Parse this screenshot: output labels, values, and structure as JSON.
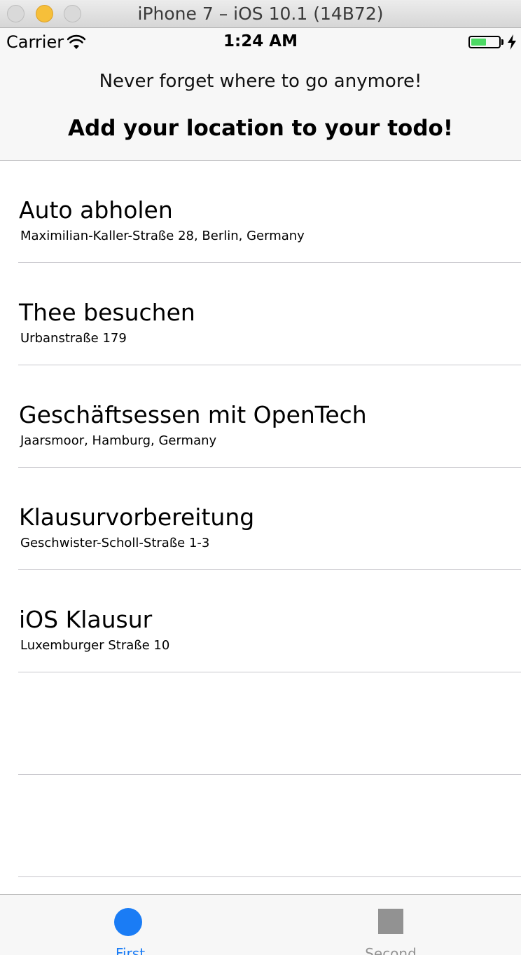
{
  "window": {
    "title": "iPhone 7 – iOS 10.1 (14B72)"
  },
  "status_bar": {
    "carrier": "Carrier",
    "time": "1:24 AM",
    "battery_level": 0.55,
    "icons": [
      "wifi-icon",
      "battery-icon",
      "charging-bolt-icon"
    ]
  },
  "header": {
    "subtitle": "Never forget where to go anymore!",
    "title": "Add your location to your todo!"
  },
  "todos": [
    {
      "title": "Auto abholen",
      "location": "Maximilian-Kaller-Straße 28, Berlin, Germany"
    },
    {
      "title": "Thee besuchen",
      "location": "Urbanstraße 179"
    },
    {
      "title": "Geschäftsessen mit OpenTech",
      "location": "Jaarsmoor, Hamburg, Germany"
    },
    {
      "title": "Klausurvorbereitung",
      "location": "Geschwister-Scholl-Straße 1-3"
    },
    {
      "title": "iOS Klausur",
      "location": "Luxemburger Straße 10"
    }
  ],
  "tab_bar": {
    "tabs": [
      {
        "label": "First",
        "icon": "circle-icon",
        "selected": true
      },
      {
        "label": "Second",
        "icon": "square-icon",
        "selected": false
      }
    ],
    "colors": {
      "active": "#1a7cf5",
      "inactive": "#929292"
    }
  },
  "colors": {
    "battery": "#4cd964",
    "separator": "#c8c7cc",
    "bar_background": "#f7f7f7"
  }
}
